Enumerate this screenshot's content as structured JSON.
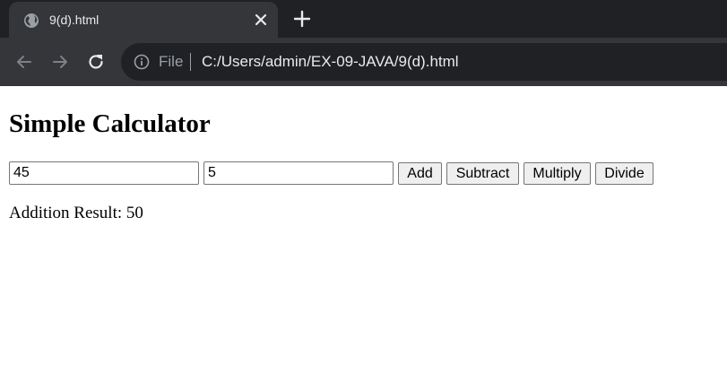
{
  "browser": {
    "tab": {
      "title": "9(d).html"
    },
    "omnibox": {
      "scheme_label": "File",
      "url": "C:/Users/admin/EX-09-JAVA/9(d).html"
    },
    "colors": {
      "tabstrip_bg": "#202124",
      "toolbar_bg": "#35363a",
      "icon": "#9aa0a6",
      "text": "#e8eaed"
    }
  },
  "page": {
    "title": "Simple Calculator",
    "inputs": {
      "first_value": "45",
      "second_value": "5"
    },
    "buttons": {
      "add": "Add",
      "subtract": "Subtract",
      "multiply": "Multiply",
      "divide": "Divide"
    },
    "result": "Addition Result: 50"
  }
}
